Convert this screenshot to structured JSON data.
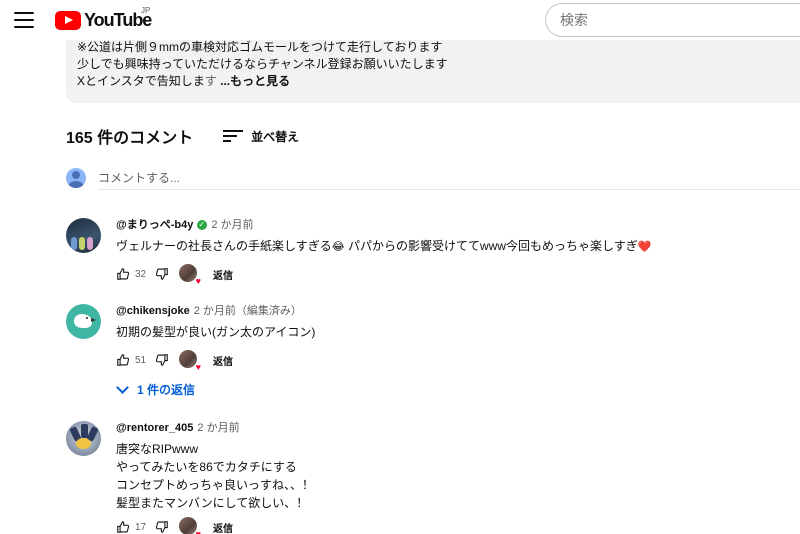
{
  "header": {
    "logo_text": "YouTube",
    "region": "JP",
    "search_placeholder": "検索"
  },
  "description": {
    "line1": "※公道は片側９mmの車検対応ゴムモールをつけて走行しております",
    "line2": "少しでも興味持っていただけるならチャンネル登録お願いいたします",
    "line3": "Xとインスタで告知しま",
    "line3_trail": "す",
    "more": "...もっと見る"
  },
  "comments_header": {
    "count": "165 件のコメント",
    "sort_label": "並べ替え"
  },
  "add_comment": {
    "placeholder": "コメントする..."
  },
  "comments": [
    {
      "author": "@まりっぺ-b4y",
      "verified_badge": true,
      "time": "2 か月前",
      "text_before_emoji": "ヴェルナーの社長さんの手紙楽しすぎる",
      "emoji1": "😂",
      "text_after_emoji": "パパからの影響受けててwww今回もめっちゃ楽しすぎ",
      "emoji2": "❤️",
      "likes": "32",
      "reply_label": "返信"
    },
    {
      "author": "@chikensjoke",
      "time": "2 か月前（編集済み）",
      "text": "初期の髪型が良い(ガン太のアイコン)",
      "likes": "51",
      "reply_label": "返信",
      "replies_toggle": "1 件の返信"
    },
    {
      "author": "@rentorer_405",
      "time": "2 か月前",
      "lines": [
        "唐突なRIPwww",
        "やってみたいを86でカタチにする",
        "コンセプトめっちゃ良いっすね、、！",
        "髪型またマンバンにして欲しい、！"
      ],
      "likes": "17",
      "reply_label": "返信"
    }
  ],
  "icons": {
    "menu": "menu-icon",
    "like": "thumb-up-icon",
    "dislike": "thumb-down-icon",
    "heart": "heart-icon",
    "sort": "sort-icon",
    "chevron": "chevron-down-icon"
  },
  "colors": {
    "brand_red": "#ff0000",
    "link_blue": "#065fd4",
    "heart_red": "#ff0033",
    "verified_green": "#2ba640"
  }
}
